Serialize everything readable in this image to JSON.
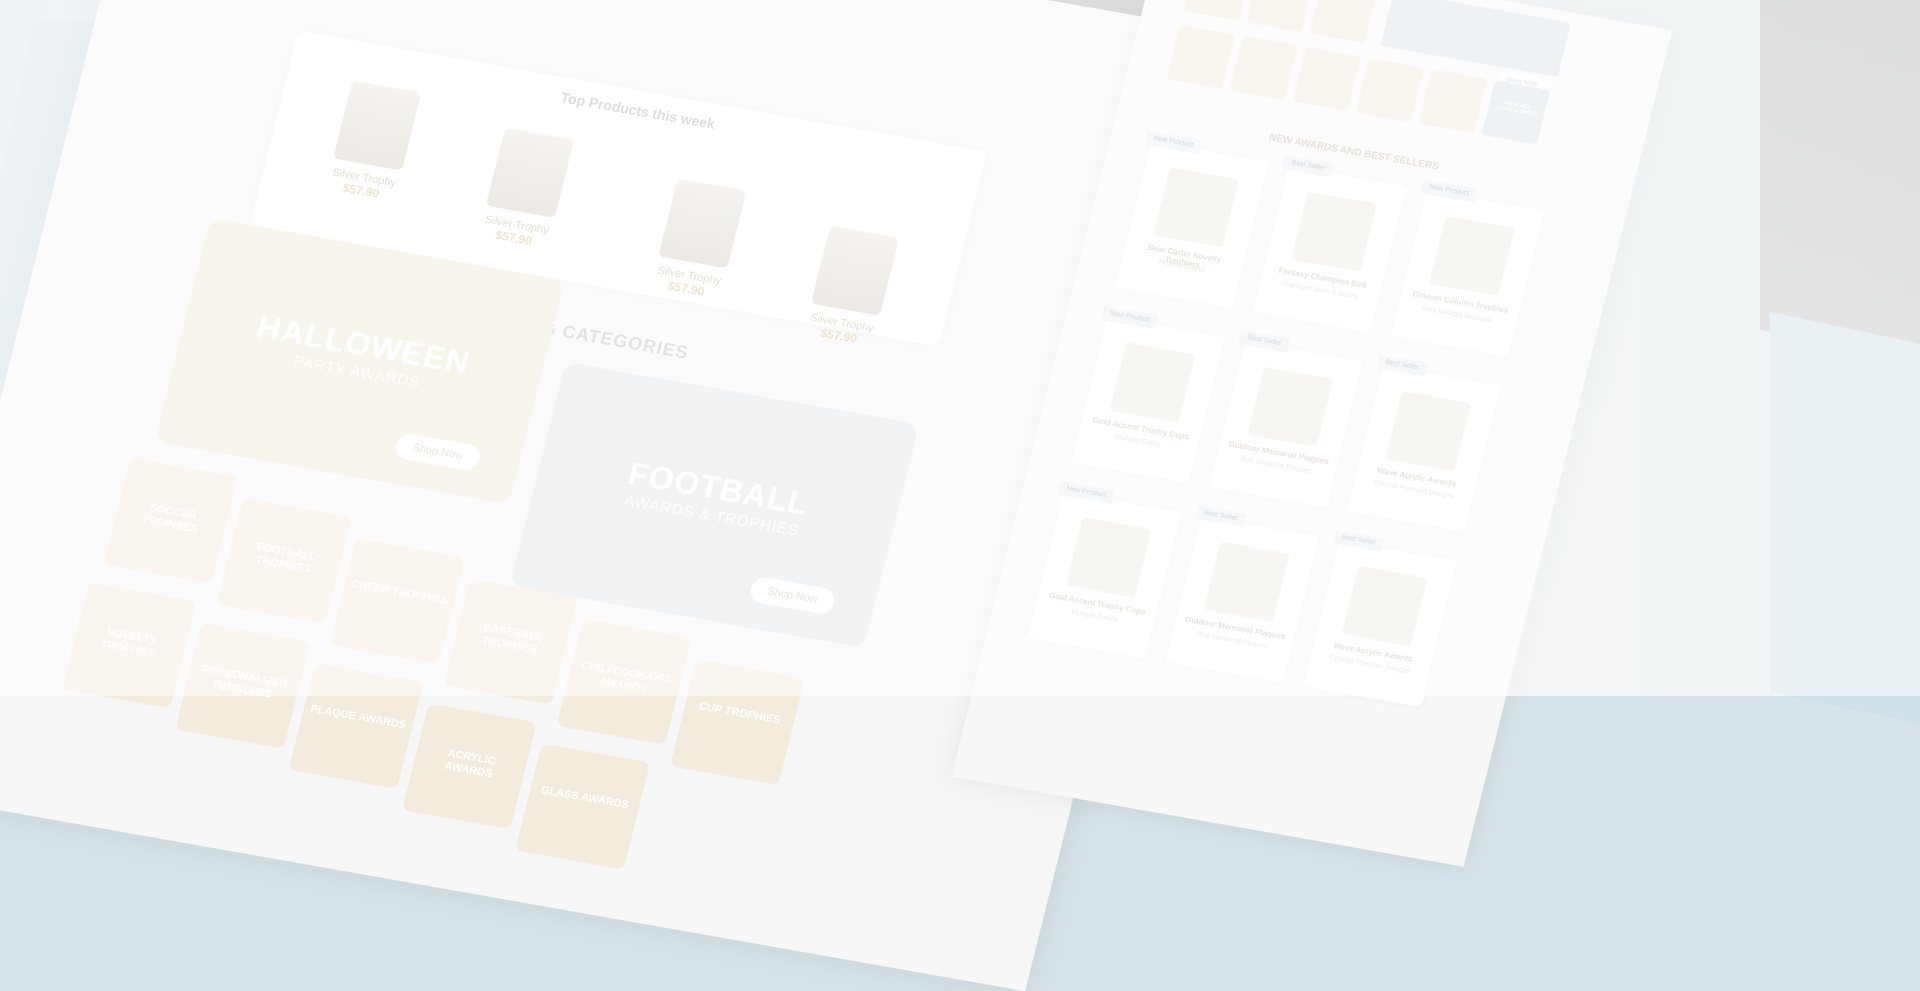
{
  "top_products": {
    "title": "Top Products this week",
    "items": [
      {
        "name": "Silver Trophy",
        "price": "$57.90"
      },
      {
        "name": "Silver Trophy",
        "price": "$57.90"
      },
      {
        "name": "Silver Trophy",
        "price": "$57.90"
      },
      {
        "name": "Silver Trophy",
        "price": "$57.90"
      }
    ]
  },
  "trending": {
    "title": "TRENDING CATEGORIES",
    "halloween": {
      "main": "HALLOWEEN",
      "sub": "PARTY AWARDS",
      "cta": "Shop Now"
    },
    "football": {
      "main": "FOOTBALL",
      "sub": "AWARDS & TROPHIES",
      "cta": "Shop Now"
    },
    "tiles": [
      "SOCCER TROPHIES",
      "FOOTBALL TROPHIES",
      "CHEER TROPHIES",
      "BASEBALL TROPHIES",
      "CHILI COOK-OFF AWARDS",
      "CUP TROPHIES",
      "NOVELTY TROPHIES",
      "PERSONALIZED TUMBLERS",
      "PLAQUE AWARDS",
      "ACRYLIC AWARDS",
      "GLASS AWARDS"
    ]
  },
  "right_page": {
    "shop_label": "Shop Now",
    "view_all": "VIEW ALL CATEGORIES",
    "section_title": "NEW AWARDS AND BEST SELLERS",
    "cards": [
      {
        "badge": "New Product",
        "name": "Bear Carter Novelty Tumblers",
        "sub": "Multiple Colors"
      },
      {
        "badge": "Best Seller",
        "name": "Fantasy Champion Belt",
        "sub": "Champion Belts & Sports"
      },
      {
        "badge": "New Product",
        "name": "Custom Column Trophies",
        "sub": "New Designs Available"
      },
      {
        "badge": "New Product",
        "name": "Gold Accent Trophy Cups",
        "sub": "Multiple Colors"
      },
      {
        "badge": "Best Seller",
        "name": "Outdoor Memorial Plaques",
        "sub": "Bulk Memorial Plaques"
      },
      {
        "badge": "Best Seller",
        "name": "Wave Acrylic Awards",
        "sub": "Colorful Premium Designs"
      },
      {
        "badge": "New Product",
        "name": "Gold Accent Trophy Cups",
        "sub": "Multiple Colors"
      },
      {
        "badge": "Best Seller",
        "name": "Outdoor Memorial Plaques",
        "sub": "Bulk Memorial Plaques"
      },
      {
        "badge": "Best Seller",
        "name": "Wave Acrylic Awards",
        "sub": "Colorful Premium Designs"
      }
    ]
  }
}
